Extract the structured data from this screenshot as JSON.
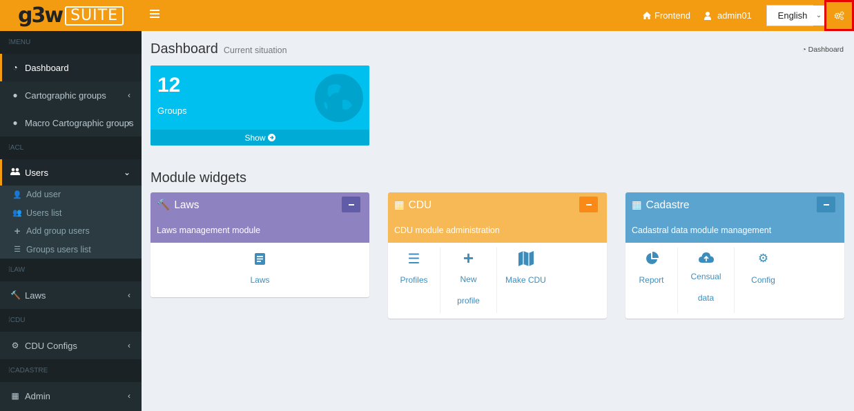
{
  "brand": {
    "part1": "g3w",
    "part2": "SUITE"
  },
  "navbar": {
    "frontend_label": "Frontend",
    "user_label": "admin01",
    "language": "English"
  },
  "sidebar": {
    "headers": [
      "MENU",
      "ACL",
      "LAW",
      "CDU",
      "CADASTRE"
    ],
    "items": [
      {
        "label": "Dashboard"
      },
      {
        "label": "Cartographic groups"
      },
      {
        "label": "Macro Cartographic groups"
      },
      {
        "label": "Users"
      },
      {
        "label": "Laws"
      },
      {
        "label": "CDU Configs"
      },
      {
        "label": "Admin"
      }
    ],
    "users_sub": [
      {
        "label": "Add user"
      },
      {
        "label": "Users list"
      },
      {
        "label": "Add group users"
      },
      {
        "label": "Groups users list"
      }
    ]
  },
  "page": {
    "title": "Dashboard",
    "subtitle": "Current situation",
    "breadcrumb": "Dashboard"
  },
  "stat_box": {
    "value": "12",
    "label": "Groups",
    "footer": "Show"
  },
  "modules_title": "Module widgets",
  "widgets": [
    {
      "title": "Laws",
      "desc": "Laws management module",
      "color": "#8e82c1",
      "links": [
        {
          "label": "Laws"
        }
      ]
    },
    {
      "title": "CDU",
      "desc": "CDU module administration",
      "color": "#f7b955",
      "links": [
        {
          "label": "Profiles"
        },
        {
          "label": "New profile"
        },
        {
          "label": "Make CDU"
        }
      ]
    },
    {
      "title": "Cadastre",
      "desc": "Cadastral data module management",
      "color": "#5ba4cf",
      "links": [
        {
          "label": "Report"
        },
        {
          "label": "Censual data"
        },
        {
          "label": "Config"
        }
      ]
    }
  ],
  "colors": {
    "accent": "#f39c12",
    "info": "#00c0ef",
    "sidebar_bg": "#222d32",
    "link": "#3c8dbc"
  }
}
